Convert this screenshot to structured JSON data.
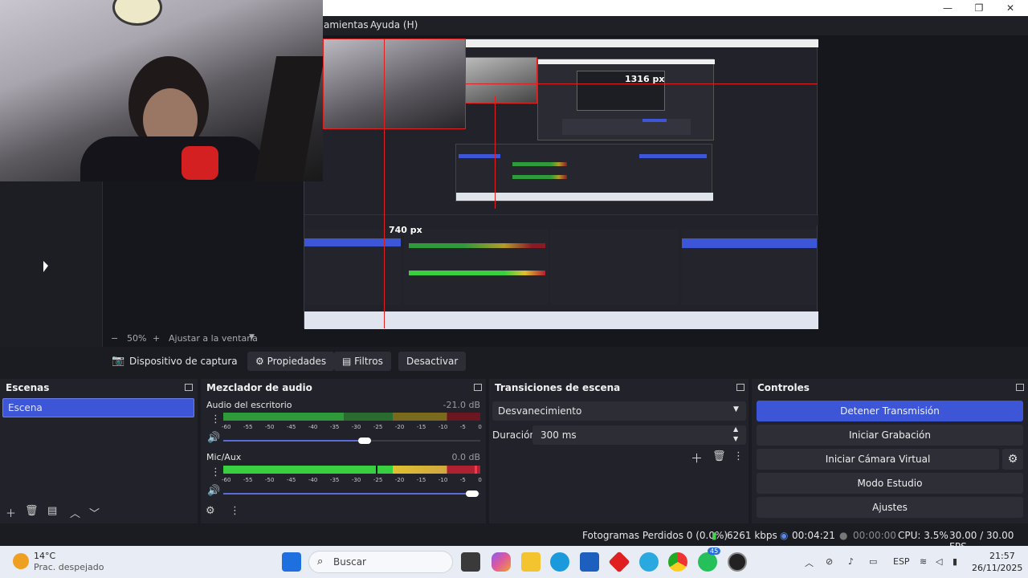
{
  "window": {
    "minimize": "—",
    "maximize": "❐",
    "close": "✕"
  },
  "menu": {
    "item1": "amientas",
    "item2": "Ayuda (H)"
  },
  "preview": {
    "measure_w": "1316 px",
    "measure_h": "740 px"
  },
  "zoom": {
    "minus": "−",
    "value": "50%",
    "plus": "+",
    "fit": "Ajustar a la ventana",
    "caret": "▼"
  },
  "source_bar": {
    "source_name": "Dispositivo de captura de v",
    "properties": "Propiedades",
    "filters": "Filtros",
    "deactivate": "Desactivar"
  },
  "scenes": {
    "title": "Escenas",
    "items": [
      "Escena"
    ]
  },
  "mixer": {
    "title": "Mezclador de audio",
    "tracks": [
      {
        "name": "Audio del escritorio",
        "db": "-21.0 dB",
        "level": 0.47,
        "volume": 0.55
      },
      {
        "name": "Mic/Aux",
        "db": "0.0 dB",
        "level": 1.0,
        "volume": 0.97
      }
    ],
    "ticks": [
      "-60",
      "-55",
      "-50",
      "-45",
      "-40",
      "-35",
      "-30",
      "-25",
      "-20",
      "-15",
      "-10",
      "-5",
      "0"
    ]
  },
  "transitions": {
    "title": "Transiciones de escena",
    "selected": "Desvanecimiento",
    "duration_label": "Duración",
    "duration_value": "300 ms"
  },
  "controls": {
    "title": "Controles",
    "stop_stream": "Detener Transmisión",
    "start_recording": "Iniciar Grabación",
    "start_virtual_cam": "Iniciar Cámara Virtual",
    "studio_mode": "Modo Estudio",
    "settings": "Ajustes"
  },
  "status": {
    "dropped": "Fotogramas Perdidos 0 (0.0%)",
    "bitrate": "6261 kbps",
    "stream_time": "00:04:21",
    "rec_time": "00:00:00",
    "cpu": "CPU: 3.5%",
    "fps": "30.00 / 30.00 FPS"
  },
  "taskbar": {
    "weather_temp": "14°C",
    "weather_desc": "Prac. despejado",
    "search": "Buscar",
    "lang": "ESP",
    "time": "21:57",
    "date": "26/11/2025",
    "badge": "45"
  }
}
